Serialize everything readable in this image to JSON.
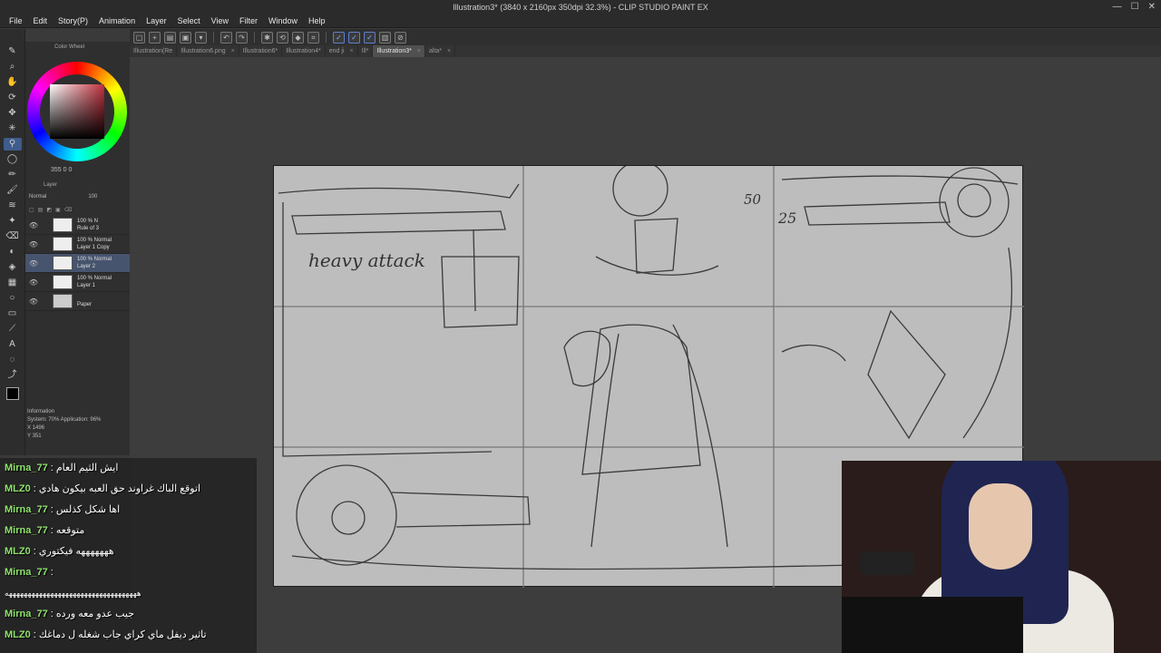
{
  "window": {
    "title": "Illustration3* (3840 x 2160px 350dpi 32.3%) - CLIP STUDIO PAINT EX",
    "controls": [
      "—",
      "☐",
      "✕"
    ]
  },
  "menu": [
    "File",
    "Edit",
    "Story(P)",
    "Animation",
    "Layer",
    "Select",
    "View",
    "Filter",
    "Window",
    "Help"
  ],
  "doc_tabs": [
    {
      "label": "Illustration(Re",
      "active": false
    },
    {
      "label": "Illustration6.png",
      "active": false
    },
    {
      "label": "Illustration6*",
      "active": false
    },
    {
      "label": "Illustration4*",
      "active": false
    },
    {
      "label": "end ji",
      "active": false
    },
    {
      "label": "Ill*",
      "active": false
    },
    {
      "label": "Illustration3*",
      "active": true
    },
    {
      "label": "alta*",
      "active": false
    }
  ],
  "color_wheel": {
    "title": "Color Wheel",
    "values": "355   0   0"
  },
  "layer_panel": {
    "header": "Layer",
    "mode": "Normal",
    "opacity": "100",
    "layers": [
      {
        "line1": "100 % N",
        "line2": "Rule of 3",
        "selected": false
      },
      {
        "line1": "100 % Normal",
        "line2": "Layer 1 Copy",
        "selected": false
      },
      {
        "line1": "100 % Normal",
        "line2": "Layer 2",
        "selected": true
      },
      {
        "line1": "100 % Normal",
        "line2": "Layer 1",
        "selected": false
      },
      {
        "line1": "",
        "line2": "Paper",
        "selected": false
      }
    ]
  },
  "info_panel": {
    "title": "Information",
    "system": "System: 70%  Application: 96%",
    "x": "1496",
    "y": "351"
  },
  "canvas_text": {
    "heavy_attack": "heavy attack",
    "num_50": "50",
    "num_25": "25"
  },
  "chat": [
    {
      "user": "Mirna_77",
      "message": "ايش الثيم العام",
      "alt": false
    },
    {
      "user": "MLZ0",
      "message": "اتوقع الباك غراوند حق العبه بيكون هادي",
      "alt": false
    },
    {
      "user": "Mirna_77",
      "message": "اها شكل كذلس",
      "alt": false
    },
    {
      "user": "Mirna_77",
      "message": "متوقعه",
      "alt": false
    },
    {
      "user": "MLZ0",
      "message": "هههههههه فيكتوري",
      "alt": false
    },
    {
      "user": "Mirna_77",
      "message": "",
      "alt": false
    },
    {
      "user": "",
      "message": "هههههههههههههههههههههههههههههههههههه",
      "alt": true
    },
    {
      "user": "Mirna_77",
      "message": "جيب عدو معه ورده",
      "alt": false
    },
    {
      "user": "MLZ0",
      "message": "تاثير ديفل ماي كراي جاب شغله ل دماغك",
      "alt": false
    }
  ]
}
